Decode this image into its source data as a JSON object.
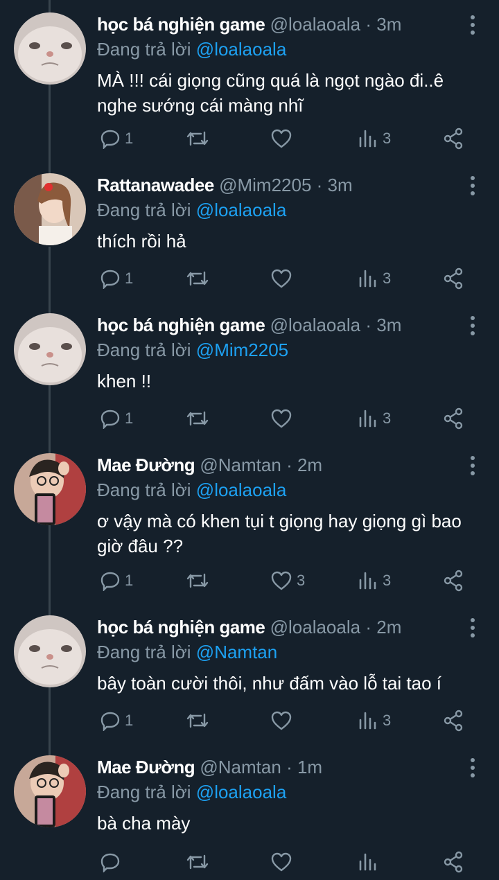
{
  "colors": {
    "background": "#15202b",
    "text": "#ffffff",
    "muted": "#8899a6",
    "link": "#1da1f2",
    "thread": "#38444d"
  },
  "common": {
    "replying_label": "Đang trả lời",
    "separator": "·"
  },
  "tweets": [
    {
      "name": "học bá nghiện game",
      "handle": "@loalaoala",
      "time": "3m",
      "reply_to": "@loalaoala",
      "text": "MÀ !!! cái giọng cũng quá là ngọt ngào đi..ê nghe sướng cái màng nhĩ",
      "replies": "1",
      "retweets": "",
      "likes": "",
      "views": "3",
      "avatar_icon": "cat-avatar"
    },
    {
      "name": "Rattanawadee",
      "handle": "@Mim2205",
      "time": "3m",
      "reply_to": "@loalaoala",
      "text": "thích rồi hả",
      "replies": "1",
      "retweets": "",
      "likes": "",
      "views": "3",
      "avatar_icon": "girl-avatar"
    },
    {
      "name": "học bá nghiện game",
      "handle": "@loalaoala",
      "time": "3m",
      "reply_to": "@Mim2205",
      "text": "khen !!",
      "replies": "1",
      "retweets": "",
      "likes": "",
      "views": "3",
      "avatar_icon": "cat-avatar"
    },
    {
      "name": "Mae Đường",
      "handle": "@Namtan",
      "time": "2m",
      "reply_to": "@loalaoala",
      "text": "ơ vậy mà có khen tụi t giọng hay giọng gì bao giờ đâu ??",
      "replies": "1",
      "retweets": "",
      "likes": "3",
      "views": "3",
      "avatar_icon": "selfie-avatar"
    },
    {
      "name": "học bá nghiện game",
      "handle": "@loalaoala",
      "time": "2m",
      "reply_to": "@Namtan",
      "text": "bây toàn cười thôi, như đấm vào lỗ tai tao í",
      "replies": "1",
      "retweets": "",
      "likes": "",
      "views": "3",
      "avatar_icon": "cat-avatar"
    },
    {
      "name": "Mae Đường",
      "handle": "@Namtan",
      "time": "1m",
      "reply_to": "@loalaoala",
      "text": "bà cha mày",
      "replies": "",
      "retweets": "",
      "likes": "",
      "views": "",
      "avatar_icon": "selfie-avatar"
    }
  ]
}
